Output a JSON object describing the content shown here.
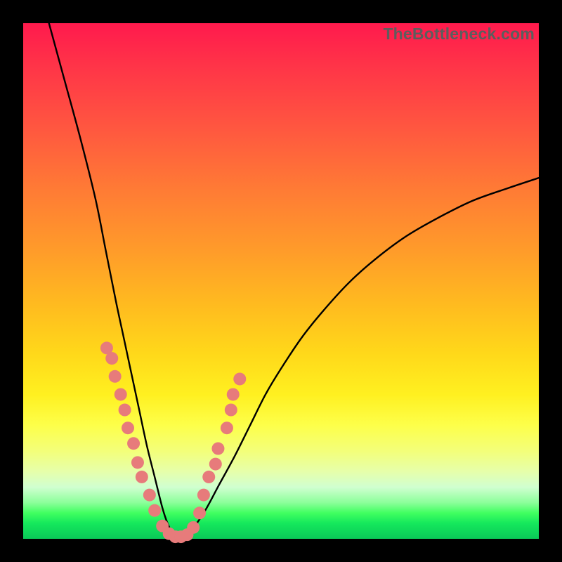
{
  "watermark": "TheBottleneck.com",
  "chart_data": {
    "type": "line",
    "title": "",
    "xlabel": "",
    "ylabel": "",
    "xlim": [
      0,
      100
    ],
    "ylim": [
      0,
      100
    ],
    "series": [
      {
        "name": "bottleneck-curve",
        "x": [
          5,
          8,
          11,
          14,
          16,
          18,
          19.5,
          21,
          22.5,
          24,
          25.5,
          27,
          28,
          29,
          30,
          32,
          35,
          38,
          41,
          44,
          47,
          50,
          54,
          58,
          63,
          68,
          74,
          80,
          87,
          94,
          100
        ],
        "y": [
          100,
          89,
          78,
          66,
          56,
          46,
          39,
          32,
          25,
          18,
          12,
          6,
          3,
          1,
          0,
          1,
          5,
          10.5,
          16,
          22,
          28,
          33,
          39,
          44,
          49.5,
          54,
          58.5,
          62,
          65.5,
          68,
          70
        ],
        "stroke": "#000000",
        "fill": "none"
      }
    ],
    "markers": [
      {
        "series": "left-points",
        "color": "#e77b7b",
        "points": [
          {
            "x": 16.2,
            "y": 37.0
          },
          {
            "x": 17.2,
            "y": 35.0
          },
          {
            "x": 17.8,
            "y": 31.5
          },
          {
            "x": 18.9,
            "y": 28.0
          },
          {
            "x": 19.7,
            "y": 25.0
          },
          {
            "x": 20.3,
            "y": 21.5
          },
          {
            "x": 21.4,
            "y": 18.5
          },
          {
            "x": 22.2,
            "y": 14.8
          },
          {
            "x": 23.0,
            "y": 12.0
          },
          {
            "x": 24.5,
            "y": 8.5
          },
          {
            "x": 25.5,
            "y": 5.5
          },
          {
            "x": 27.0,
            "y": 2.5
          },
          {
            "x": 28.3,
            "y": 1.0
          },
          {
            "x": 29.5,
            "y": 0.4
          },
          {
            "x": 30.6,
            "y": 0.4
          }
        ]
      },
      {
        "series": "right-points",
        "color": "#e77b7b",
        "points": [
          {
            "x": 31.8,
            "y": 0.8
          },
          {
            "x": 33.0,
            "y": 2.2
          },
          {
            "x": 34.2,
            "y": 5.0
          },
          {
            "x": 35.0,
            "y": 8.5
          },
          {
            "x": 36.0,
            "y": 12.0
          },
          {
            "x": 37.3,
            "y": 14.5
          },
          {
            "x": 37.8,
            "y": 17.5
          },
          {
            "x": 39.5,
            "y": 21.5
          },
          {
            "x": 40.3,
            "y": 25.0
          },
          {
            "x": 40.7,
            "y": 28.0
          },
          {
            "x": 42.0,
            "y": 31.0
          }
        ]
      }
    ]
  }
}
